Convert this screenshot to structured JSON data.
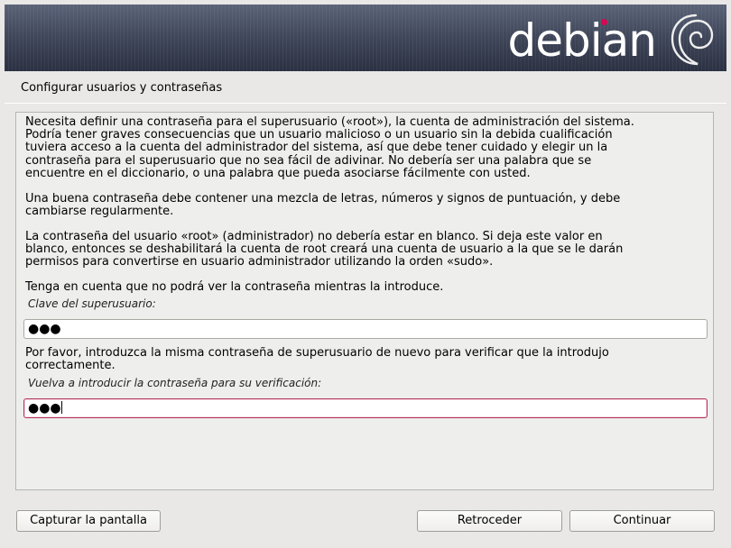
{
  "banner": {
    "logo_text": "debian",
    "logo_icon": "debian-swirl-icon",
    "accent_color": "#d70751"
  },
  "page": {
    "title": "Configurar usuarios y contraseñas"
  },
  "content": {
    "para1": "Necesita definir una contraseña para el superusuario («root»), la cuenta de administración del sistema.\nPodría tener graves consecuencias que un usuario malicioso o un usuario sin la debida cualificación\ntuviera acceso a la cuenta del administrador del sistema, así que debe tener cuidado y elegir un la\ncontraseña para el superusuario que no sea fácil de adivinar. No debería ser una palabra que se\nencuentre en el diccionario, o una palabra que pueda asociarse fácilmente con usted.",
    "para2": "Una buena contraseña debe contener una mezcla de letras, números y signos de puntuación, y debe\ncambiarse regularmente.",
    "para3": "La contraseña del usuario «root» (administrador) no debería estar en blanco. Si deja este valor en\nblanco, entonces se deshabilitará la cuenta de root creará una cuenta de usuario a la que se le darán\npermisos para convertirse en usuario administrador utilizando la orden «sudo».",
    "para4": "Tenga en cuenta que no podrá ver la contraseña mientras la introduce.",
    "root_password_label": "Clave del superusuario:",
    "root_password_value": "●●●",
    "verify_instructions": "Por favor, introduzca la misma contraseña de superusuario de nuevo para verificar que la introdujo\ncorrectamente.",
    "verify_password_label": "Vuelva a introducir la contraseña para su verificación:",
    "verify_password_value": "●●●"
  },
  "buttons": {
    "screenshot": "Capturar la pantalla",
    "back": "Retroceder",
    "continue": "Continuar"
  }
}
